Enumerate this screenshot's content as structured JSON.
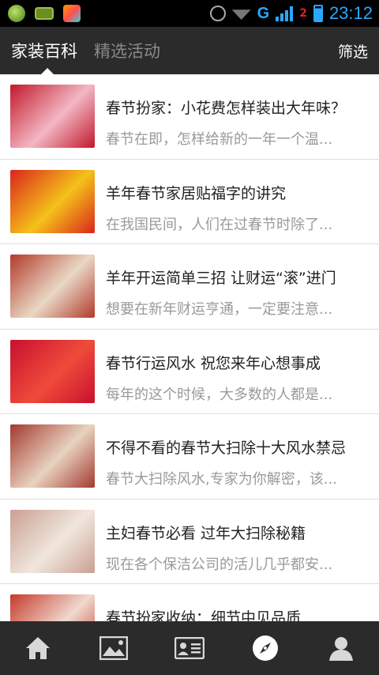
{
  "status_bar": {
    "time": "23:12",
    "network": "G",
    "sim_badge": "2"
  },
  "header": {
    "tabs": [
      {
        "label": "家装百科"
      },
      {
        "label": "精选活动"
      }
    ],
    "filter_label": "筛选"
  },
  "articles": [
    {
      "title": "春节扮家：小花费怎样装出大年味？",
      "summary": "春节在即，怎样给新的一年一个温...",
      "thumb_colors": [
        "#c2182b",
        "#f3b7c4"
      ]
    },
    {
      "title": "羊年春节家居贴福字的讲究",
      "summary": "在我国民间，人们在过春节时除了...",
      "thumb_colors": [
        "#d9261c",
        "#f5c21a"
      ]
    },
    {
      "title": "羊年开运简单三招 让财运“滚”进门",
      "summary": "想要在新年财运亨通，一定要注意...",
      "thumb_colors": [
        "#b23a2c",
        "#e9d8c5"
      ]
    },
    {
      "title": "春节行运风水 祝您来年心想事成",
      "summary": "每年的这个时候，大多数的人都是...",
      "thumb_colors": [
        "#c8102e",
        "#ef4b3a"
      ]
    },
    {
      "title": "不得不看的春节大扫除十大风水禁忌",
      "summary": "春节大扫除风水,专家为你解密，该...",
      "thumb_colors": [
        "#a33a2f",
        "#e8d3c0"
      ]
    },
    {
      "title": "主妇春节必看 过年大扫除秘籍",
      "summary": "现在各个保洁公司的活儿几乎都安...",
      "thumb_colors": [
        "#c9a090",
        "#f1e6de"
      ]
    },
    {
      "title": "春节扮家收纳：细节中见品质",
      "summary": "",
      "thumb_colors": [
        "#c53a2b",
        "#f0d9cf"
      ]
    }
  ],
  "bottom_nav": [
    {
      "icon": "home-icon"
    },
    {
      "icon": "gallery-icon"
    },
    {
      "icon": "contact-card-icon"
    },
    {
      "icon": "compass-icon"
    },
    {
      "icon": "user-icon"
    }
  ]
}
